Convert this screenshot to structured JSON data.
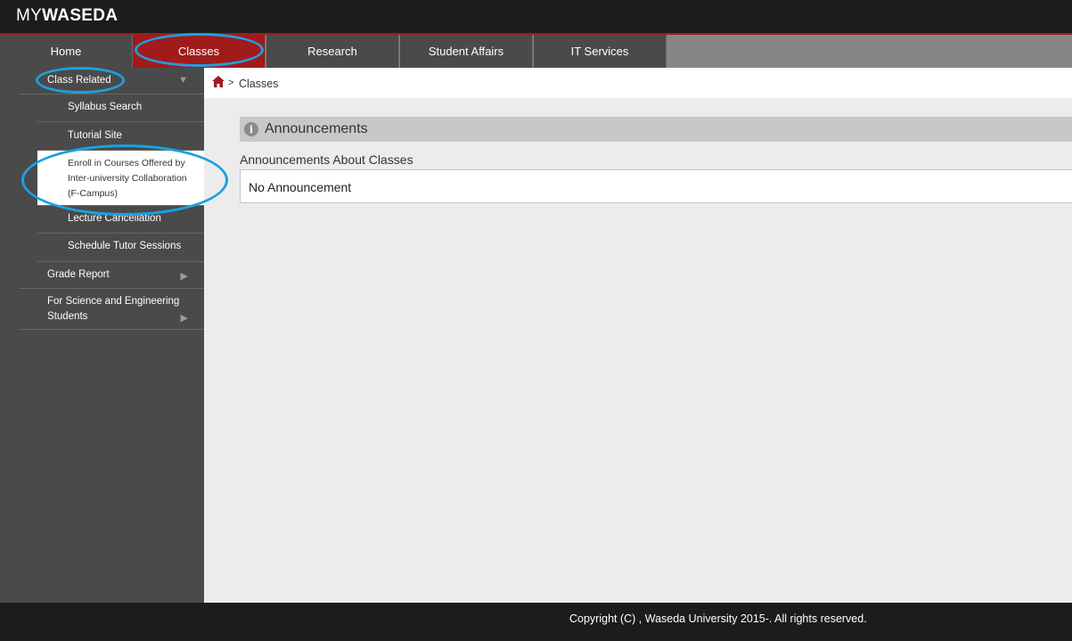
{
  "header": {
    "logo_my": "MY",
    "logo_waseda": "WASEDA"
  },
  "nav": {
    "tabs": [
      {
        "label": "Home"
      },
      {
        "label": "Classes",
        "active": true
      },
      {
        "label": "Research"
      },
      {
        "label": "Student Affairs"
      },
      {
        "label": "IT Services"
      }
    ]
  },
  "sidebar": {
    "class_related": "Class Related",
    "syllabus_search": "Syllabus Search",
    "tutorial_site": "Tutorial Site",
    "enroll_line1": "Enroll in Courses Offered by",
    "enroll_line2": "Inter-university Collaboration",
    "enroll_line3": "(F-Campus)",
    "lecture_cancellation": "Lecture Cancellation",
    "schedule_tutor": "Schedule Tutor Sessions",
    "grade_report": "Grade Report",
    "science_line1": "For Science and Engineering",
    "science_line2": "Students"
  },
  "breadcrumb": {
    "separator": ">",
    "current": "Classes"
  },
  "announcements": {
    "title": "Announcements",
    "subtitle": "Announcements About Classes",
    "empty_text": "No Announcement"
  },
  "footer": {
    "copyright": "Copyright (C) , Waseda University 2015-. All rights reserved."
  },
  "colors": {
    "brand_red": "#a11b1b",
    "annotation_blue": "#1ba1e2",
    "header_bg": "#1c1c1c",
    "sidebar_bg": "#4a4a4a"
  },
  "icons": {
    "home": "home-icon",
    "info": "info-icon",
    "arrow_down": "triangle-down-icon",
    "arrow_right": "triangle-right-icon"
  }
}
